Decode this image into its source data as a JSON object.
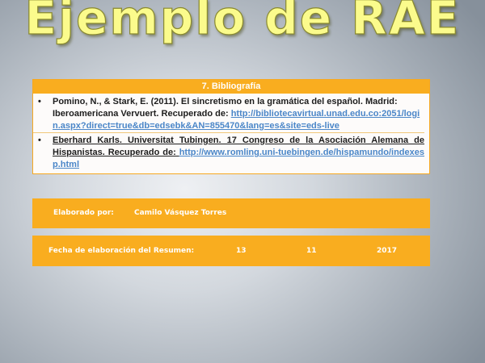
{
  "slide": {
    "title": "Ejemplo de RAE"
  },
  "bibliography": {
    "header": "7.   Bibliografía",
    "items": [
      {
        "text": "Pomino, N., & Stark, E. (2011). El sincretismo en la gramática del español. Madrid: Iberoamericana Vervuert. Recuperado de: ",
        "link": "http://bibliotecavirtual.unad.edu.co:2051/login.aspx?direct=true&db=edsebk&AN=855470&lang=es&site=eds-live"
      },
      {
        "text": "Eberhard Karls. Universitat Tubingen. 17 Congreso de la Asociación Alemana de Hispanistas. Recuperado de: ",
        "link": "http://www.romling.uni-tuebingen.de/hispamundo/indexesp.html"
      }
    ]
  },
  "author_box": {
    "label": "Elaborado por:",
    "name": "Camilo Vásquez Torres"
  },
  "date_box": {
    "label": "Fecha de elaboración del Resumen:",
    "day": "13",
    "month": "11",
    "year": "2017"
  },
  "colors": {
    "accent_orange": "#f9ad1f",
    "title_yellow": "#fbfb8c",
    "link_blue": "#4a86c8"
  }
}
